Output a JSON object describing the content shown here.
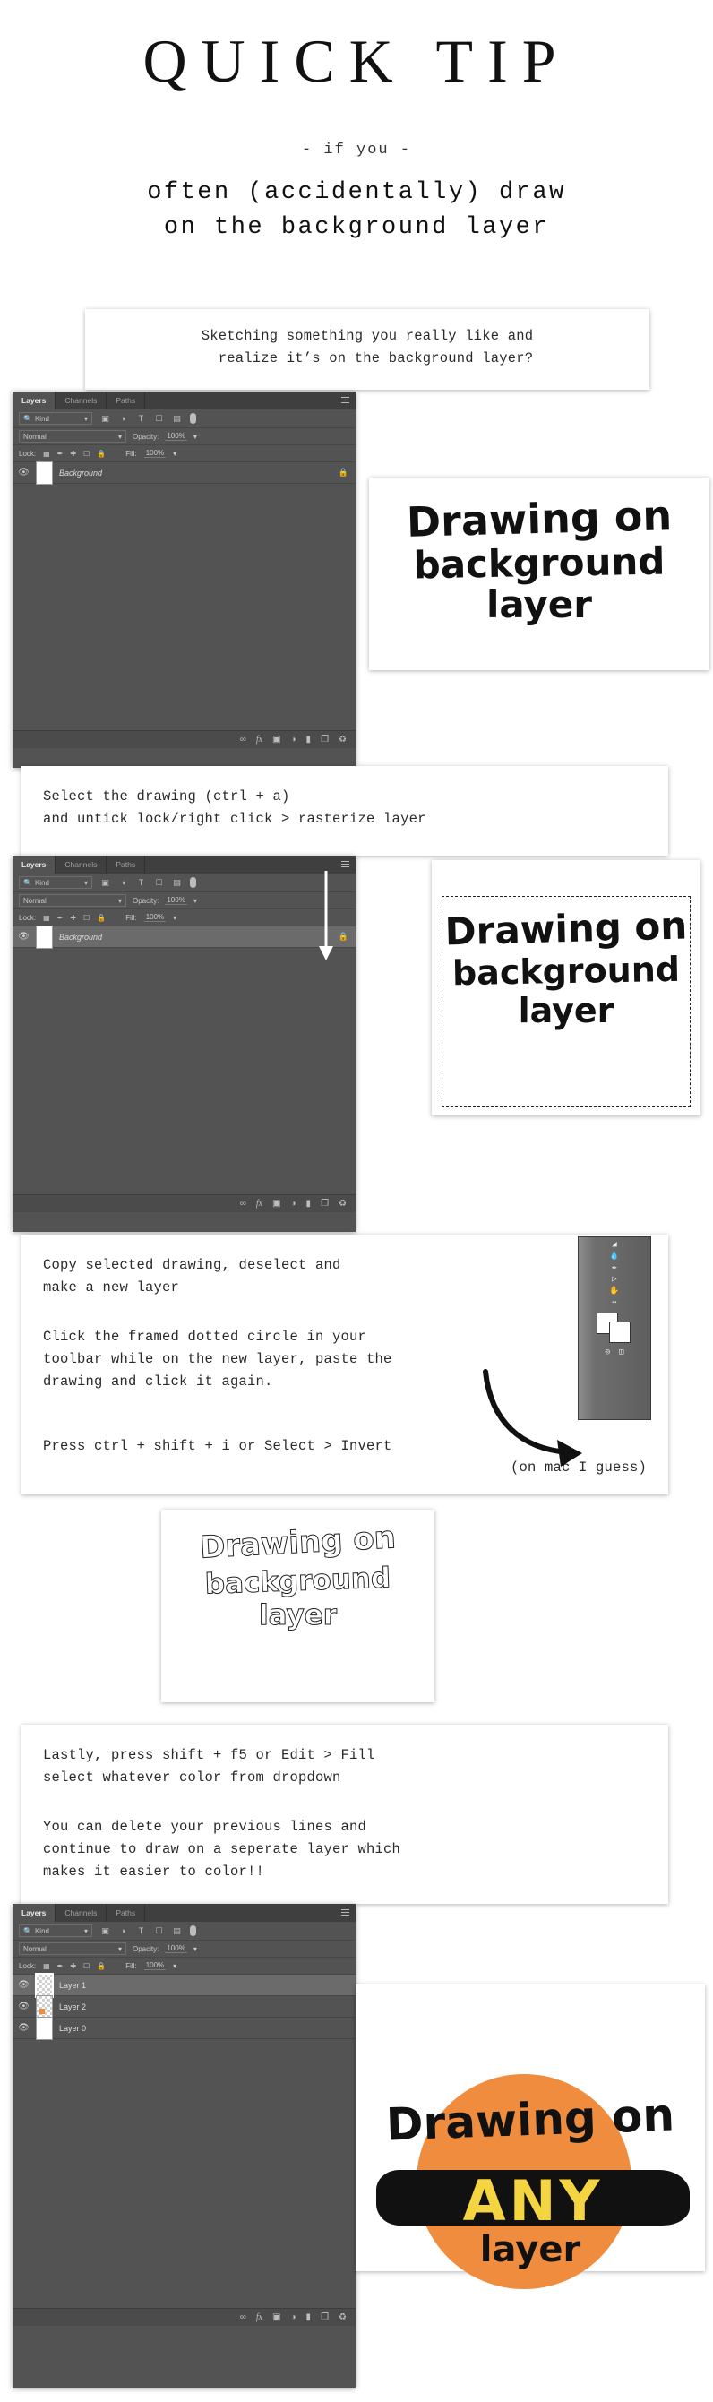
{
  "header": {
    "title": "QUICK TIP",
    "subtitle": "- if you -",
    "lead_line1": "often (accidentally) draw",
    "lead_line2": "on the background layer"
  },
  "steps": [
    {
      "id": "step1",
      "note": "Sketching something you really like and\n  realize it’s on the background layer?"
    },
    {
      "id": "step2",
      "note": "Select the drawing (ctrl + a)\nand untick lock/right click > rasterize layer"
    },
    {
      "id": "step3",
      "note_a": "Copy selected drawing, deselect and\nmake a new layer",
      "note_b": "Click the framed dotted circle in your\ntoolbar while on the new layer, paste the\ndrawing and click it again.",
      "note_c": "Press ctrl + shift + i or Select > Invert",
      "note_d": "(on mac I guess)"
    },
    {
      "id": "step4",
      "note": "Lastly, press shift + f5 or Edit > Fill\nselect whatever color from dropdown",
      "note_b": "You can delete your previous lines and\ncontinue to draw on a seperate layer which\nmakes it easier to color!!"
    }
  ],
  "photoshop": {
    "tabs": [
      "Layers",
      "Channels",
      "Paths"
    ],
    "active_tab": "Layers",
    "filter_placeholder": "Kind",
    "blend_mode": "Normal",
    "opacity_label": "Opacity:",
    "opacity_value": "100%",
    "lock_label": "Lock:",
    "fill_label": "Fill:",
    "fill_value": "100%",
    "filter_icons": [
      "image-filter-icon",
      "adjustment-filter-icon",
      "type-filter-icon",
      "shape-filter-icon",
      "smart-object-filter-icon",
      "filter-toggle-pill"
    ],
    "lock_icons": [
      "lock-transparent-icon",
      "lock-image-icon",
      "lock-position-icon",
      "lock-artboard-icon",
      "lock-all-icon"
    ],
    "footer_icons": [
      "link-layers-icon",
      "fx-icon",
      "add-mask-icon",
      "adjustment-layer-icon",
      "new-group-icon",
      "new-layer-icon",
      "delete-layer-icon"
    ],
    "footer_glyphs": [
      "⚭",
      "fx",
      "▣",
      "◑",
      "▰",
      "❐",
      "🗑"
    ]
  },
  "panel1": {
    "layers": [
      {
        "name": "Background",
        "italic": true,
        "locked": true,
        "selected": false,
        "thumb": "white"
      }
    ]
  },
  "panel2": {
    "layers": [
      {
        "name": "Background",
        "italic": true,
        "locked": true,
        "selected": true,
        "thumb": "white"
      }
    ]
  },
  "panel3": {
    "layers": [
      {
        "name": "Layer 1",
        "italic": false,
        "locked": false,
        "selected": true,
        "thumb": "checker"
      },
      {
        "name": "Layer 2",
        "italic": false,
        "locked": false,
        "selected": false,
        "thumb": "checker"
      },
      {
        "name": "Layer 0",
        "italic": false,
        "locked": false,
        "selected": false,
        "thumb": "white"
      }
    ]
  },
  "drawings": {
    "line1": "Drawing on",
    "line2": "background",
    "line3": "layer",
    "final_line1": "Drawing on",
    "final_word": "ANY",
    "final_line3": "layer"
  },
  "colors": {
    "panel_bg": "#535353",
    "panel_tab_bg": "#3f3f3f",
    "panel_selected": "#6b6b6b",
    "orange": "#ef8c3d",
    "yellow": "#f5d442",
    "ink": "#111111"
  }
}
